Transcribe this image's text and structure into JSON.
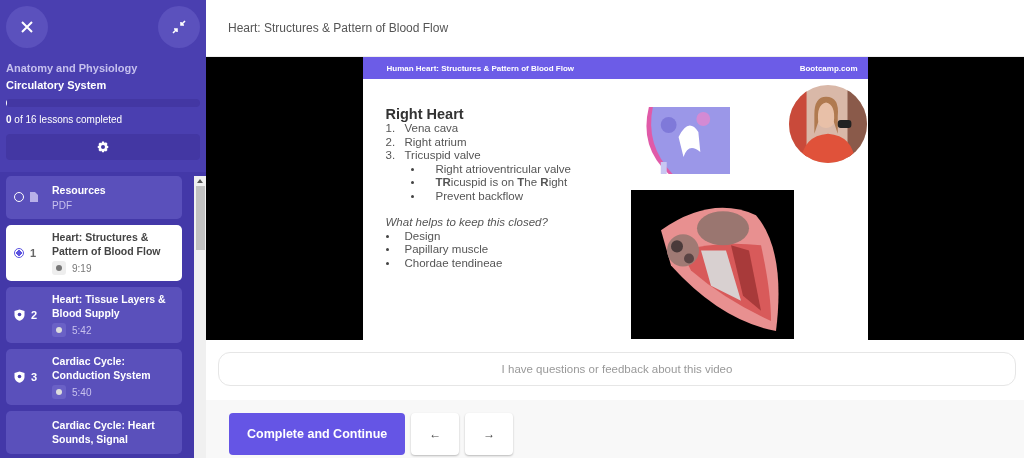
{
  "sidebar": {
    "course_title": "Anatomy and Physiology",
    "section_title": "Circulatory System",
    "progress": {
      "level": 0
    },
    "progress_text": "**0** of 16 lessons completed",
    "lessons": [
      {
        "kind": "resource",
        "title": "Resources",
        "subtitle": "PDF",
        "selected": false,
        "locked": false
      },
      {
        "kind": "lesson",
        "number": "1",
        "title": "Heart: Structures & Pattern of Blood Flow",
        "duration": "9:19",
        "selected": true,
        "locked": false
      },
      {
        "kind": "lesson",
        "number": "2",
        "title": "Heart: Tissue Layers & Blood Supply",
        "duration": "5:42",
        "selected": false,
        "locked": true
      },
      {
        "kind": "lesson",
        "number": "3",
        "title": "Cardiac Cycle: Conduction System",
        "duration": "5:40",
        "selected": false,
        "locked": true
      },
      {
        "kind": "lesson",
        "title": "Cardiac Cycle: Heart Sounds, Signal",
        "selected": false
      }
    ]
  },
  "header": {
    "title": "Heart: Structures & Pattern of Blood Flow"
  },
  "slide": {
    "banner_title": "Human Heart: Structures & Pattern of Blood Flow",
    "banner_site": "Bootcamp.com",
    "heading": "Right Heart",
    "numbered": [
      {
        "number": "1.",
        "text": "Vena cava"
      },
      {
        "number": "2.",
        "text": "Right atrium"
      },
      {
        "number": "3.",
        "text": "Tricuspid valve"
      }
    ],
    "sub_bullets": [
      "Right atrioventricular valve",
      "**TR**icuspid is on **T**he **R**ight",
      "Prevent backflow"
    ],
    "question": "What helps to keep this closed?",
    "bullets": [
      "Design",
      "Papillary muscle",
      "Chordae tendineae"
    ]
  },
  "feedback": {
    "placeholder": "I have questions or feedback about this video"
  },
  "footer": {
    "complete_button": "Complete and Continue",
    "prev_button": "←",
    "next_button": "→"
  }
}
